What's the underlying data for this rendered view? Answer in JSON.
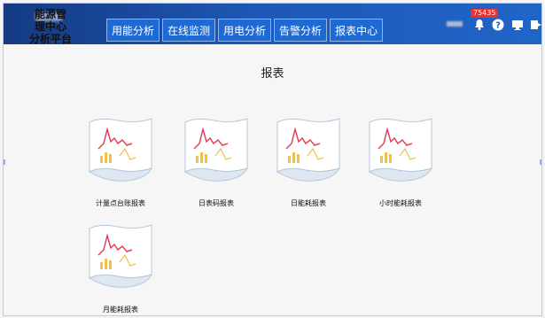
{
  "header": {
    "platform_title": "能源管\n理中心\n分析平台",
    "nav_tabs": [
      {
        "label": "用能分析"
      },
      {
        "label": "在线监测"
      },
      {
        "label": "用电分析"
      },
      {
        "label": "告警分析"
      },
      {
        "label": "报表中心"
      }
    ],
    "alarm_count": "75435",
    "icons": [
      "alarm-bell-icon",
      "help-icon",
      "monitor-icon",
      "exit-icon"
    ]
  },
  "main": {
    "heading": "报表",
    "reports": [
      {
        "label": "计量点台账报表"
      },
      {
        "label": "日表码报表"
      },
      {
        "label": "日能耗报表"
      },
      {
        "label": "小时能耗报表"
      },
      {
        "label": "月能耗报表"
      }
    ]
  },
  "colors": {
    "header_gradient_start": "#143a83",
    "header_gradient_end": "#1f65c7",
    "tab_fill": "#1f6ad2",
    "badge_red": "#e6312e"
  }
}
